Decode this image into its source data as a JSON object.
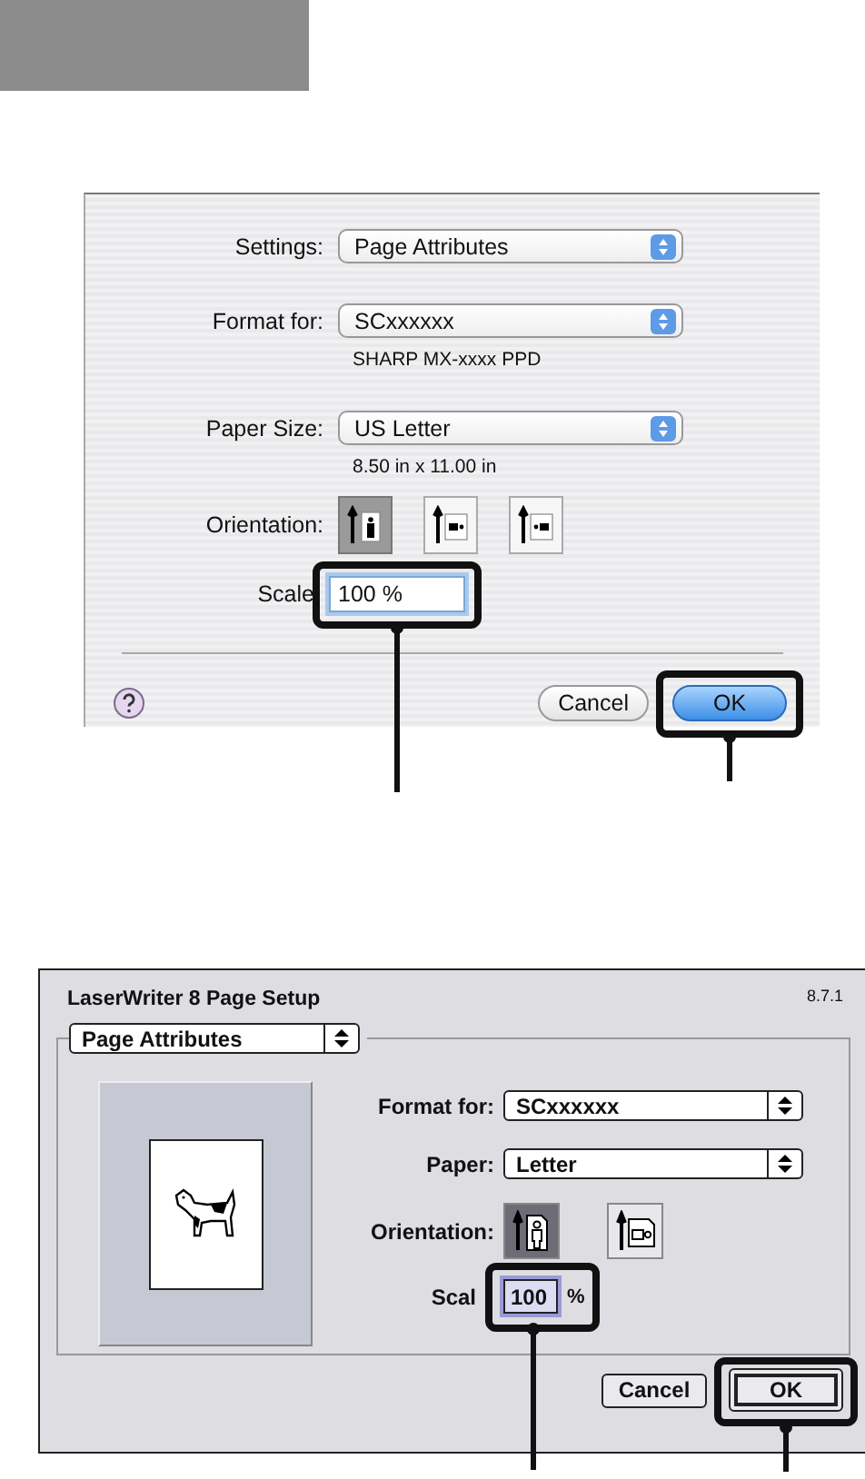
{
  "mac_dialog": {
    "settings": {
      "label": "Settings:",
      "value": "Page Attributes"
    },
    "format_for": {
      "label": "Format for:",
      "value": "SCxxxxxx",
      "detail": "SHARP MX-xxxx PPD"
    },
    "paper_size": {
      "label": "Paper Size:",
      "value": "US Letter",
      "detail": "8.50 in x 11.00 in"
    },
    "orientation": {
      "label": "Orientation:",
      "options": [
        {
          "kind": "portrait",
          "selected": true
        },
        {
          "kind": "landscape",
          "selected": false
        },
        {
          "kind": "reverse_landscape",
          "selected": false
        }
      ]
    },
    "scale": {
      "label": "Scale",
      "value": "100 %",
      "highlighted": true
    },
    "buttons": [
      {
        "label": "Cancel",
        "default": false,
        "highlighted": false
      },
      {
        "label": "OK",
        "default": true,
        "highlighted": true
      }
    ]
  },
  "classic_dialog": {
    "title": "LaserWriter 8 Page Setup",
    "version": "8.7.1",
    "settings": "Page Attributes",
    "format_for": {
      "label": "Format for:",
      "value": "SCxxxxxx"
    },
    "paper": {
      "label": "Paper:",
      "value": "Letter"
    },
    "orientation": {
      "label": "Orientation:",
      "options": [
        {
          "kind": "portrait",
          "selected": true
        },
        {
          "kind": "landscape",
          "selected": false
        }
      ]
    },
    "scale": {
      "label": "Scal",
      "value": "100",
      "unit": "%",
      "highlighted": true
    },
    "buttons": [
      {
        "label": "Cancel",
        "default": false,
        "highlighted": false
      },
      {
        "label": "OK",
        "default": true,
        "highlighted": true
      }
    ]
  }
}
